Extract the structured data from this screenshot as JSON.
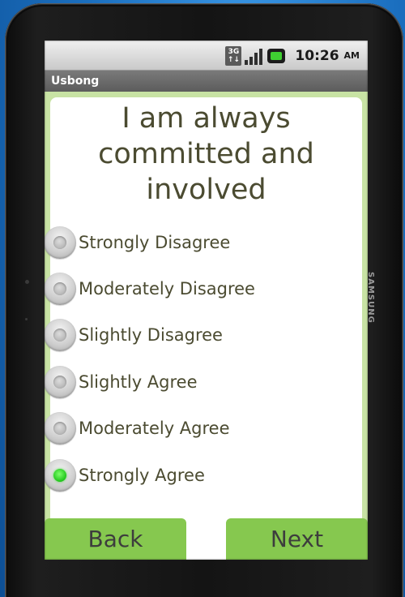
{
  "device": {
    "brand": "SAMSUNG"
  },
  "status_bar": {
    "network_badge_top": "3G",
    "network_badge_bottom": "↑↓",
    "time": "10:26",
    "ampm": "AM",
    "battery_color": "#3fcf32"
  },
  "app": {
    "title": "Usbong"
  },
  "question": {
    "text": "I am always committed and involved"
  },
  "options": [
    {
      "label": "Strongly Disagree",
      "selected": false
    },
    {
      "label": "Moderately Disagree",
      "selected": false
    },
    {
      "label": "Slightly Disagree",
      "selected": false
    },
    {
      "label": "Slightly Agree",
      "selected": false
    },
    {
      "label": "Moderately Agree",
      "selected": false
    },
    {
      "label": "Strongly Agree",
      "selected": true
    }
  ],
  "buttons": {
    "back_label": "Back",
    "next_label": "Next"
  },
  "colors": {
    "button_green": "#86c84f",
    "content_border": "#c8e3a4",
    "selected_radio": "#1fc51a"
  }
}
